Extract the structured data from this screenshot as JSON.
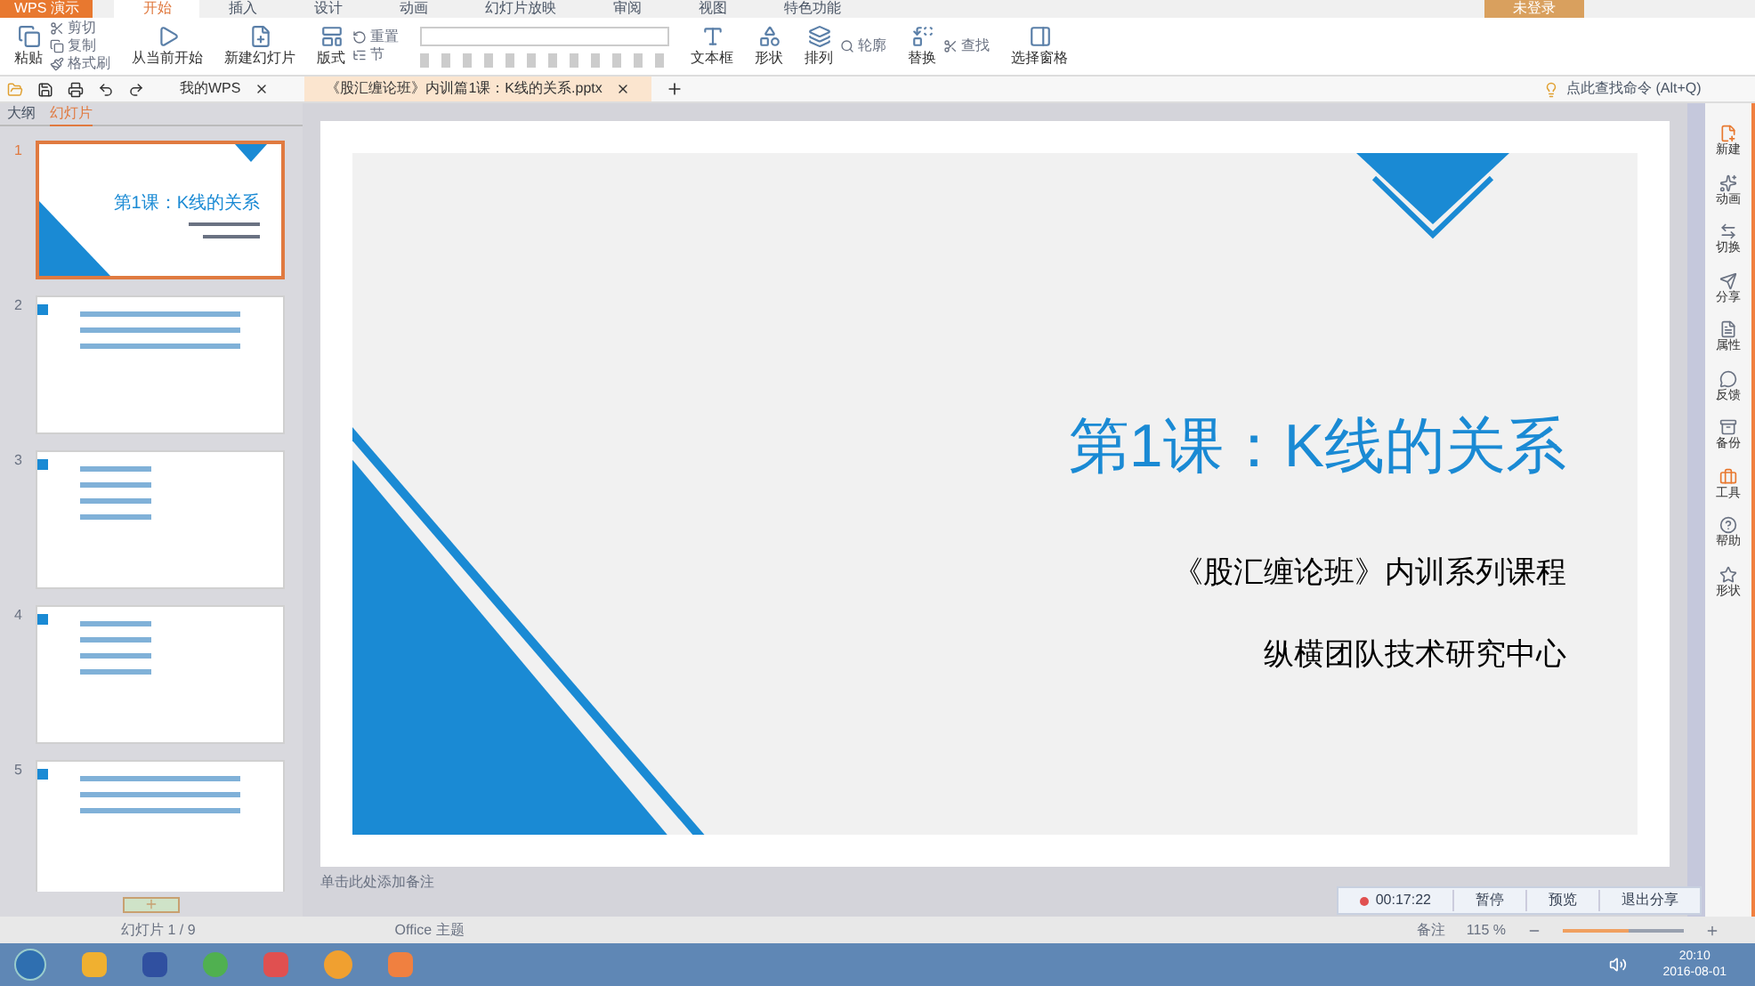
{
  "app_button": "WPS 演示",
  "menu_tabs": [
    {
      "label": "开始",
      "selected": true
    },
    {
      "label": "插入",
      "selected": false
    },
    {
      "label": "设计",
      "selected": false
    },
    {
      "label": "动画",
      "selected": false
    },
    {
      "label": "幻灯片放映",
      "selected": false
    },
    {
      "label": "审阅",
      "selected": false
    },
    {
      "label": "视图",
      "selected": false
    },
    {
      "label": "特色功能",
      "selected": false
    }
  ],
  "login": "未登录",
  "ribbon": [
    {
      "large": "粘贴",
      "small": [
        "剪切",
        "复制",
        "格式刷"
      ]
    },
    {
      "large": "从当前开始"
    },
    {
      "large": "新建幻灯片"
    },
    {
      "large": "版式",
      "small": [
        "重置",
        "节"
      ]
    },
    {
      "large": "文本框"
    },
    {
      "large": "形状"
    },
    {
      "large": "排列",
      "small": [
        "轮廓"
      ]
    },
    {
      "large": "替换",
      "small": [
        "查找"
      ]
    },
    {
      "large": "选择窗格"
    }
  ],
  "doc_tabs": [
    {
      "label": "我的WPS",
      "selected": false
    },
    {
      "label": "《股汇缠论班》内训篇1课：K线的关系.pptx",
      "selected": true
    }
  ],
  "command_search": {
    "placeholder": "点此查找命令 (Alt+Q)"
  },
  "panel_tabs": [
    {
      "label": "大纲",
      "selected": false
    },
    {
      "label": "幻灯片",
      "selected": true
    }
  ],
  "slides": [
    {
      "number": "1",
      "selected": true,
      "kind": "title",
      "title": "第1课：K线的关系"
    },
    {
      "number": "2",
      "selected": false,
      "kind": "text"
    },
    {
      "number": "3",
      "selected": false,
      "kind": "list"
    },
    {
      "number": "4",
      "selected": false,
      "kind": "list"
    },
    {
      "number": "5",
      "selected": false,
      "kind": "text"
    }
  ],
  "slide": {
    "title": "第1课：K线的关系",
    "subtitle": "《股汇缠论班》内训系列课程",
    "org": "纵横团队技术研究中心"
  },
  "notes": {
    "placeholder": "单击此处添加备注"
  },
  "recording": {
    "time": "00:17:22",
    "buttons": [
      "暂停",
      "预览",
      "退出分享"
    ]
  },
  "side_tools": [
    "新建",
    "动画",
    "切换",
    "分享",
    "属性",
    "反馈",
    "备份",
    "工具",
    "帮助",
    "形状"
  ],
  "status_bar": {
    "slide_counter": "幻灯片 1 / 9",
    "theme": "Office 主题",
    "notes": "备注",
    "zoom": "115 %",
    "level": 0.55
  },
  "taskbar": {
    "time": "20:10",
    "date": "2016-08-01"
  }
}
